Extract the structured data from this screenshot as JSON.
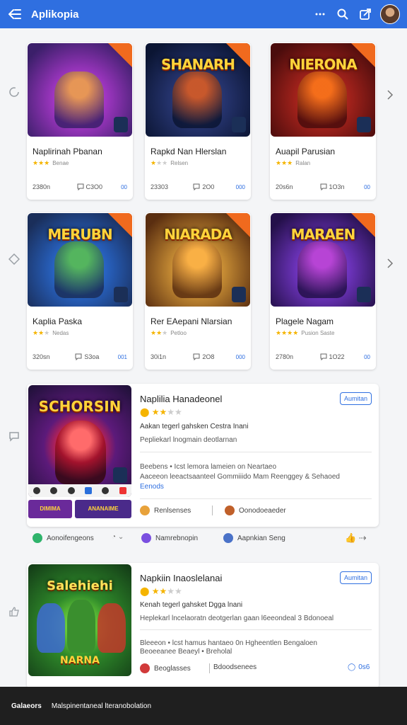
{
  "app": {
    "title": "Aplikopia"
  },
  "top_icons": [
    "more-icon",
    "search-icon",
    "share-icon",
    "avatar"
  ],
  "grid_row1": [
    {
      "name": "Naplirinah Pbanan",
      "logo": "",
      "stars": 3,
      "sub": "Benae",
      "downloads": "2380n",
      "comments": "C3O0",
      "more": "00"
    },
    {
      "name": "Rapkd Nan Hlerslan",
      "logo": "SHANARH",
      "stars": 1,
      "sub": "Relsen",
      "downloads": "23303",
      "comments": "2O0",
      "more": "000"
    },
    {
      "name": "Auapil Parusian",
      "logo": "NIERONA",
      "stars": 3,
      "sub": "Ralan",
      "downloads": "20s6n",
      "comments": "1O3n",
      "more": "00"
    }
  ],
  "grid_row2": [
    {
      "name": "Kaplia Paska",
      "logo": "MERUBN",
      "stars": 2,
      "sub": "Nedas",
      "downloads": "320sn",
      "comments": "S3oa",
      "more": "001"
    },
    {
      "name": "Rer EAepani Nlarsian",
      "logo": "NIARADA",
      "stars": 2,
      "sub": "Petloo",
      "downloads": "30i1n",
      "comments": "2O8",
      "more": "000"
    },
    {
      "name": "Plagele Nagam",
      "logo": "MARAEN",
      "stars": 4,
      "sub": "Pusion Saste",
      "downloads": "2780n",
      "comments": "1O22",
      "more": "00"
    }
  ],
  "featured": [
    {
      "name": "Naplilia Hanadeonel",
      "logo": "SCHORSIN",
      "badge": "Aumitan",
      "stars": 2,
      "line1": "Aakan tegerl gahsken Cestra Inani",
      "line2": "Pepliekarl lnogmain deotlarnan",
      "line3": "Beebens • Icst lemora lameien on Neartaeo",
      "line4": "Aaceeon leeactsaanteel Gommiiido Mam Reenggey & Sehaoed",
      "line5": "Eenods",
      "chip1": "Renlsenses",
      "chip2": "Oonodoeaeder",
      "thumb_logos": [
        "DIMIMA",
        "ANANAIME"
      ]
    },
    {
      "name": "Napkiin Inaoslelanai",
      "logo": "Salehiehi",
      "logo2": "NARNA",
      "badge": "Aumitan",
      "stars": 2,
      "line1": "Kenah tegerl gahsket Dgga lnani",
      "line2": "Heplekarl lncelaoratn deotgerlan gaan l6eeondeal 3 Bdonoeal",
      "line3": "Bleeeon • lcst hamus hantaeo 0n Hgheentlen Bengaloen",
      "line4": "Beoeeanee Beaeyl • Breholal",
      "chip1": "Beoglasses",
      "chip2": "Bdoodsenees",
      "more": "0s6"
    }
  ],
  "action_row": {
    "left": "Aonoifengeons",
    "mid": "Namrebnopin",
    "right": "Aapnkian Seng"
  },
  "bottom": {
    "label": "Galaeors",
    "text": "Malspinentaneal lteranobolation"
  }
}
